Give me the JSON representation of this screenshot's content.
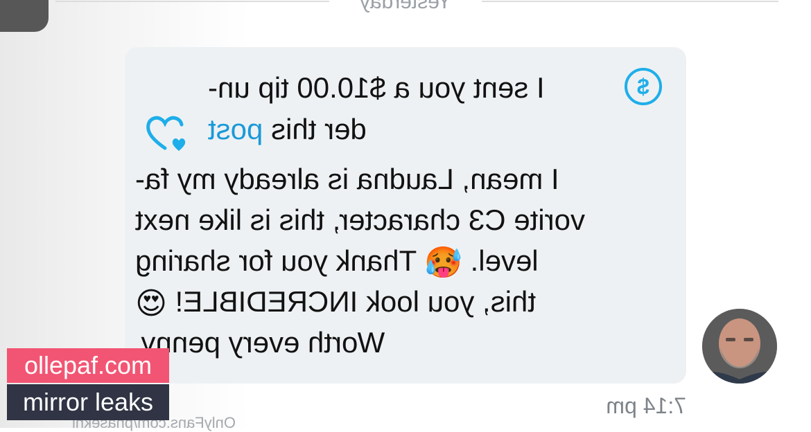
{
  "date_separator": "Yesterday",
  "tip": {
    "line1": "I sent you a $10.00 tip un-",
    "line2_prefix": "der this ",
    "line2_link": "post",
    "icon": "dollar-circle-icon",
    "icon_glyph": "$"
  },
  "like_icon": "heart-icon",
  "message": {
    "lines": [
      "I mean, Laudna is already my fa-",
      "vorite C3 character, this is like next",
      "level.",
      "this, you look INCREDIBLE!",
      "Worth every penny."
    ],
    "line3_after_emoji": " Thank you for sharing",
    "emoji_hot": "🥵",
    "emoji_heart_eyes": "😍"
  },
  "timestamp": "7:14 pm",
  "profile_url": "OnlyFans.com/phasekni",
  "watermark": {
    "site": "ollepaf.com",
    "tagline": "mirror leaks"
  },
  "colors": {
    "accent": "#1eaee9",
    "link": "#1a9ad8",
    "bubble": "#eef1f3",
    "watermark_pink": "#f25573",
    "watermark_dark": "#303444"
  }
}
